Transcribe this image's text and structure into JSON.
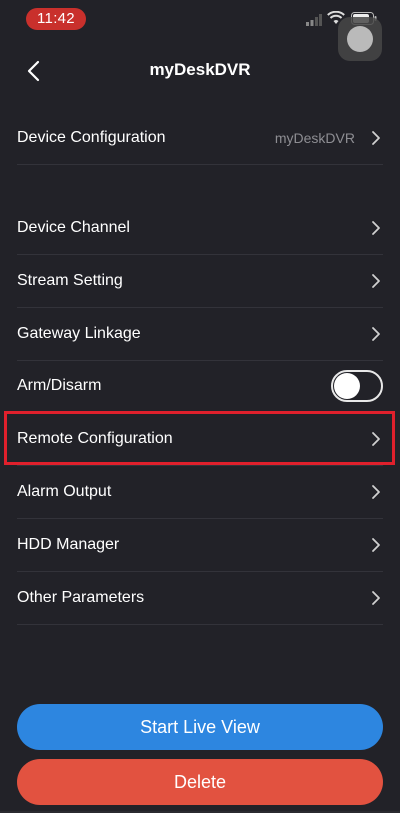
{
  "status_bar": {
    "time": "11:42"
  },
  "nav": {
    "title": "myDeskDVR",
    "back_icon": "chevron-left-icon"
  },
  "device_configuration": {
    "label": "Device Configuration",
    "value": "myDeskDVR"
  },
  "menu": {
    "device_channel": "Device Channel",
    "stream_setting": "Stream Setting",
    "gateway_linkage": "Gateway Linkage",
    "arm_disarm": "Arm/Disarm",
    "remote_configuration": "Remote Configuration",
    "alarm_output": "Alarm Output",
    "hdd_manager": "HDD Manager",
    "other_parameters": "Other Parameters"
  },
  "arm_disarm_toggle": {
    "on": false
  },
  "buttons": {
    "start_live_view": "Start Live View",
    "delete": "Delete"
  },
  "colors": {
    "background": "#222228",
    "primary": "#2d86e0",
    "danger": "#e25240",
    "highlight": "#e0202c",
    "time_pill": "#c9302c"
  }
}
